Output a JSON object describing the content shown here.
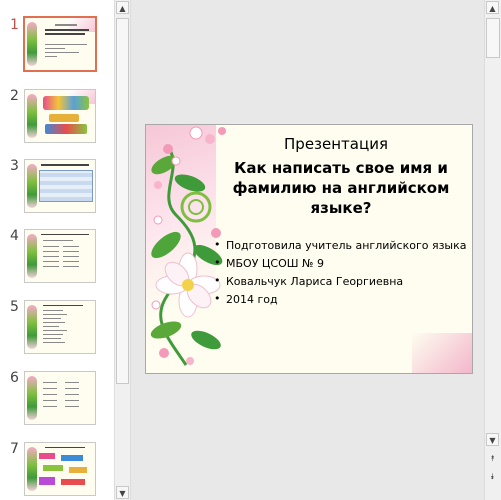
{
  "thumbnails": [
    {
      "number": "1",
      "active": true
    },
    {
      "number": "2",
      "active": false
    },
    {
      "number": "3",
      "active": false
    },
    {
      "number": "4",
      "active": false
    },
    {
      "number": "5",
      "active": false
    },
    {
      "number": "6",
      "active": false
    },
    {
      "number": "7",
      "active": false
    }
  ],
  "slide": {
    "title_line1": "Презентация",
    "title_line2": "Как написать свое имя и фамилию на английском языке?",
    "bullets": [
      "Подготовила учитель английского языка",
      "МБОУ ЦСОШ № 9",
      "Ковальчук Лариса Георгиевна",
      "2014 год"
    ]
  },
  "scrollbar": {
    "up_arrow": "▲",
    "down_arrow": "▼",
    "prev_slide": "⯭",
    "next_slide": "⯯"
  },
  "colors": {
    "active_border": "#e07050",
    "slide_bg": "#fefdf0",
    "pink": "#f6c7d6",
    "green": "#3f9a3a"
  }
}
